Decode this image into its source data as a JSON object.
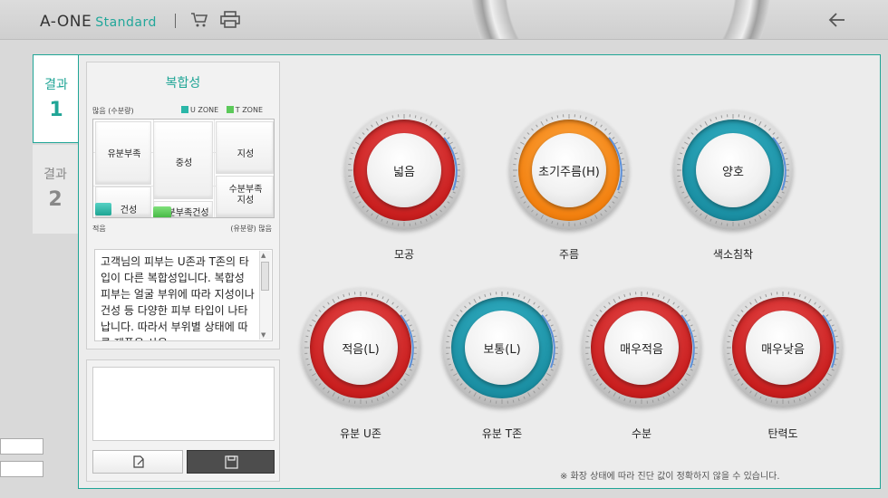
{
  "header": {
    "brand": "A-ONE",
    "brand_sub": "Standard"
  },
  "tabs": [
    {
      "label": "결과",
      "num": "1"
    },
    {
      "label": "결과",
      "num": "2"
    }
  ],
  "skin_type": {
    "title": "복합성",
    "axis_top": "많음 (수분량)",
    "axis_bottom_left": "적음",
    "axis_bottom_right": "(유분량) 많음",
    "legend": [
      {
        "label": "U ZONE",
        "color": "#2bb7a8"
      },
      {
        "label": "T ZONE",
        "color": "#5cc95a"
      }
    ],
    "cells": {
      "oily_dehydrated": "유분부족",
      "normal": "중성",
      "oily": "지성",
      "dry": "건성",
      "dehydrated_dry": "수분부족건성",
      "dehydrated_oily": "수분부족\n지성"
    },
    "description": "고객님의 피부는 U존과 T존의 타입이 다른 복합성입니다. 복합성 피부는 얼굴 부위에 따라 지성이나 건성 등 다양한 피부 타입이 나타납니다. 따라서 부위별 상태에 따른 제품을 사용"
  },
  "dials": [
    {
      "value": "넓음",
      "label": "모공",
      "color": "red"
    },
    {
      "value": "초기주름(H)",
      "label": "주름",
      "color": "orange"
    },
    {
      "value": "양호",
      "label": "색소침착",
      "color": "teal"
    },
    {
      "value": "적음(L)",
      "label": "유분 U존",
      "color": "red"
    },
    {
      "value": "보통(L)",
      "label": "유분 T존",
      "color": "teal"
    },
    {
      "value": "매우적음",
      "label": "수분",
      "color": "red"
    },
    {
      "value": "매우낮음",
      "label": "탄력도",
      "color": "red"
    }
  ],
  "notice": "※ 화장 상태에 따라 진단 값이 정확하지 않을 수 있습니다.",
  "colors": {
    "accent": "#20a596",
    "red": "#c81e1e",
    "orange": "#f2800f",
    "teal": "#1a8ea2"
  }
}
